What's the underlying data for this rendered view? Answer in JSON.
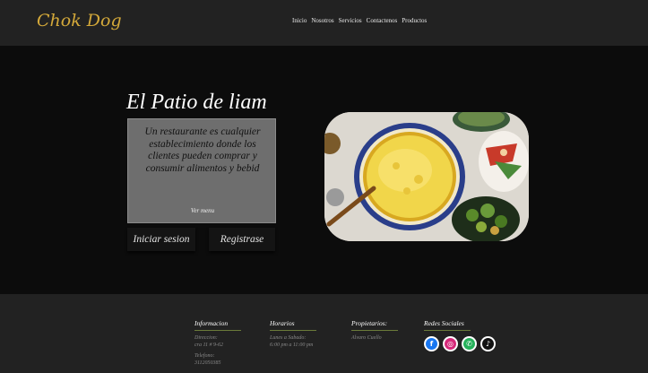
{
  "header": {
    "brand": "Chok Dog",
    "nav": [
      "Inicio",
      "Nosotros",
      "Servicios",
      "Contactenos",
      "Productos"
    ]
  },
  "hero": {
    "title": "El Patio de liam",
    "description": "Un restaurante es cualquier establecimiento donde los clientes pueden comprar y consumir alimentos y bebid",
    "menu_link": "Ver menu",
    "login_button": "Iniciar sesion",
    "register_button": "Registrase"
  },
  "footer": {
    "info": {
      "heading": "Informacion",
      "address_label": "Direccion:",
      "address": "cra 11 # 9-62",
      "phone_label": "Telefono:",
      "phone": "3112050385"
    },
    "hours": {
      "heading": "Horarios",
      "days": "Lunes a Sabado:",
      "time": "6:00 pm a 11:00 pm"
    },
    "owners": {
      "heading": "Propietarios:",
      "name": "Alvaro Cuello"
    },
    "social": {
      "heading": "Redes Sociales",
      "icons": [
        "facebook-icon",
        "instagram-icon",
        "whatsapp-icon",
        "tiktok-icon"
      ]
    }
  },
  "colors": {
    "brand": "#d4a93a",
    "nav_bg": "#222222",
    "page_bg": "#0c0c0c",
    "box_bg": "#6e6e6e",
    "divider": "#6a7a3a"
  }
}
